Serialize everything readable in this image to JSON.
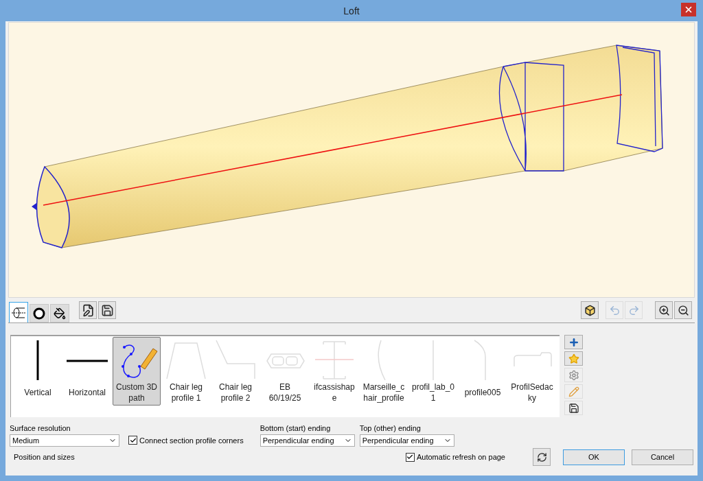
{
  "window": {
    "title": "Loft"
  },
  "view_tabs": [
    {
      "kind": "path",
      "selected": true
    },
    {
      "kind": "section",
      "selected": false
    },
    {
      "kind": "paint",
      "selected": false
    }
  ],
  "file_buttons": [
    {
      "kind": "edit"
    },
    {
      "kind": "save"
    }
  ],
  "view_buttons": [
    {
      "kind": "cube",
      "disabled": false
    },
    {
      "kind": "undo",
      "disabled": true
    },
    {
      "kind": "redo",
      "disabled": true
    },
    {
      "kind": "zoom-in",
      "disabled": false
    },
    {
      "kind": "zoom-out",
      "disabled": false
    }
  ],
  "paths": [
    {
      "label_lines": [
        "Vertical"
      ],
      "kind": "vertical",
      "selected": false
    },
    {
      "label_lines": [
        "Horizontal"
      ],
      "kind": "horizontal",
      "selected": false
    },
    {
      "label_lines": [
        "Custom 3D",
        "path"
      ],
      "kind": "custom",
      "selected": true
    },
    {
      "label_lines": [
        "Chair leg",
        "profile 1"
      ],
      "kind": "trapezoid",
      "selected": false
    },
    {
      "label_lines": [
        "Chair leg",
        "profile 2"
      ],
      "kind": "chair",
      "selected": false
    },
    {
      "label_lines": [
        "EB",
        "60/19/25"
      ],
      "kind": "eb",
      "selected": false
    },
    {
      "label_lines": [
        "ifcassishap",
        "e"
      ],
      "kind": "ibeam",
      "selected": false
    },
    {
      "label_lines": [
        "Marseille_c",
        "hair_profile"
      ],
      "kind": "arc",
      "selected": false
    },
    {
      "label_lines": [
        "profil_lab_0",
        "1"
      ],
      "kind": "line",
      "selected": false
    },
    {
      "label_lines": [
        "profile005"
      ],
      "kind": "bend",
      "selected": false
    },
    {
      "label_lines": [
        "ProfilSedac",
        "ky"
      ],
      "kind": "seat",
      "selected": false
    }
  ],
  "side_buttons": [
    {
      "kind": "add",
      "disabled": false
    },
    {
      "kind": "favorite",
      "disabled": false
    },
    {
      "kind": "settings",
      "disabled": true
    },
    {
      "kind": "edit",
      "disabled": true
    },
    {
      "kind": "save",
      "disabled": true
    }
  ],
  "surface_resolution": {
    "label": "Surface resolution",
    "value": "Medium"
  },
  "connect_corners": {
    "label": "Connect section profile corners",
    "checked": true
  },
  "bottom_ending": {
    "label": "Bottom (start) ending",
    "value": "Perpendicular ending"
  },
  "top_ending": {
    "label": "Top (other) ending",
    "value": "Perpendicular ending"
  },
  "position_section": "Position and sizes",
  "auto_refresh": {
    "label": "Automatic refresh on page",
    "checked": true
  },
  "buttons": [
    "OK",
    "Cancel"
  ]
}
